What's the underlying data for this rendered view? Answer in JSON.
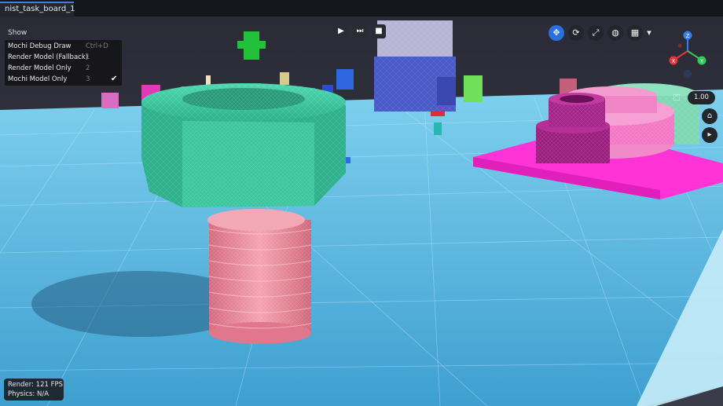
{
  "tab": {
    "label": "nist_task_board_1"
  },
  "show_menu": {
    "title": "Show",
    "items": [
      {
        "label": "Mochi Debug Draw",
        "shortcut": "Ctrl+D",
        "checked": false
      },
      {
        "label": "Render Model (Fallback)",
        "shortcut": "1",
        "checked": false
      },
      {
        "label": "Render Model Only",
        "shortcut": "2",
        "checked": false
      },
      {
        "label": "Mochi Model Only",
        "shortcut": "3",
        "checked": true
      }
    ],
    "check_glyph": "✔"
  },
  "playback": {
    "play_icon": "▶",
    "step_icon": "⏭",
    "stop_icon": "■"
  },
  "toolbar": {
    "move_icon": "✥",
    "rotate_icon": "⟳",
    "scale_icon": "⤢",
    "world_icon": "◍",
    "grid_icon": "▦",
    "dropdown_icon": "▾"
  },
  "gizmo": {
    "x_label": "X",
    "y_label": "Y",
    "z_label": "Z"
  },
  "camera": {
    "speed_icon": "⏍",
    "speed_value": "1.00",
    "home_icon": "⌂",
    "video_icon": "▸"
  },
  "stats": {
    "render": "Render:  121 FPS",
    "physics": "Physics: N/A"
  },
  "colors": {
    "floor": "#5ab8e0",
    "nut": "#35c29a",
    "bolt": "#e88a9a",
    "board_magenta": "#ff2ed0",
    "gear_pink": "#f070b8",
    "gear_purple": "#9a1a7a",
    "accent": "#2a6fe0"
  }
}
